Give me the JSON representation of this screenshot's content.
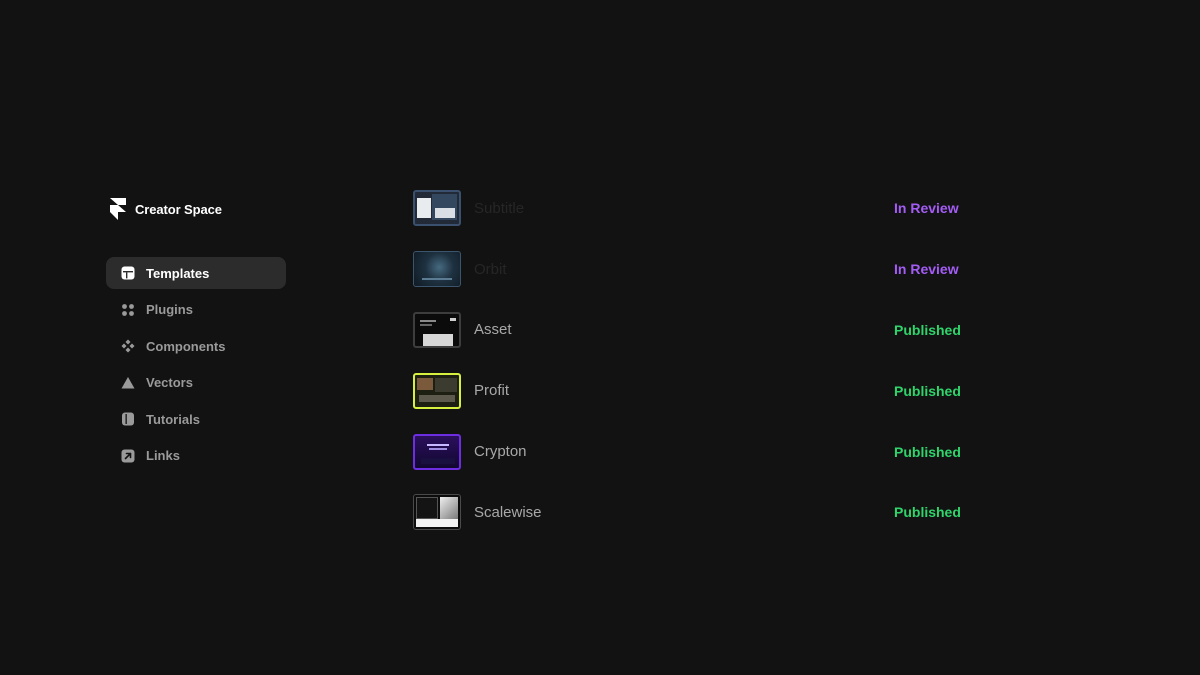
{
  "brand": {
    "name": "Creator Space",
    "icon": "framer-logo-icon"
  },
  "nav": {
    "items": [
      {
        "label": "Templates",
        "icon": "templates-icon",
        "active": true
      },
      {
        "label": "Plugins",
        "icon": "plugins-icon",
        "active": false
      },
      {
        "label": "Components",
        "icon": "components-icon",
        "active": false
      },
      {
        "label": "Vectors",
        "icon": "vectors-icon",
        "active": false
      },
      {
        "label": "Tutorials",
        "icon": "tutorials-icon",
        "active": false
      },
      {
        "label": "Links",
        "icon": "links-icon",
        "active": false
      }
    ]
  },
  "templates": [
    {
      "name": "Subtitle",
      "status": "In Review",
      "status_color": "#a45cf6",
      "name_dimmed": true
    },
    {
      "name": "Orbit",
      "status": "In Review",
      "status_color": "#a45cf6",
      "name_dimmed": true
    },
    {
      "name": "Asset",
      "status": "Published",
      "status_color": "#2fd46b",
      "name_dimmed": false
    },
    {
      "name": "Profit",
      "status": "Published",
      "status_color": "#2fd46b",
      "name_dimmed": false
    },
    {
      "name": "Crypton",
      "status": "Published",
      "status_color": "#2fd46b",
      "name_dimmed": false
    },
    {
      "name": "Scalewise",
      "status": "Published",
      "status_color": "#2fd46b",
      "name_dimmed": false
    }
  ],
  "colors": {
    "background": "#121212",
    "active_nav_bg": "#2c2c2c",
    "in_review": "#a45cf6",
    "published": "#2fd46b"
  }
}
